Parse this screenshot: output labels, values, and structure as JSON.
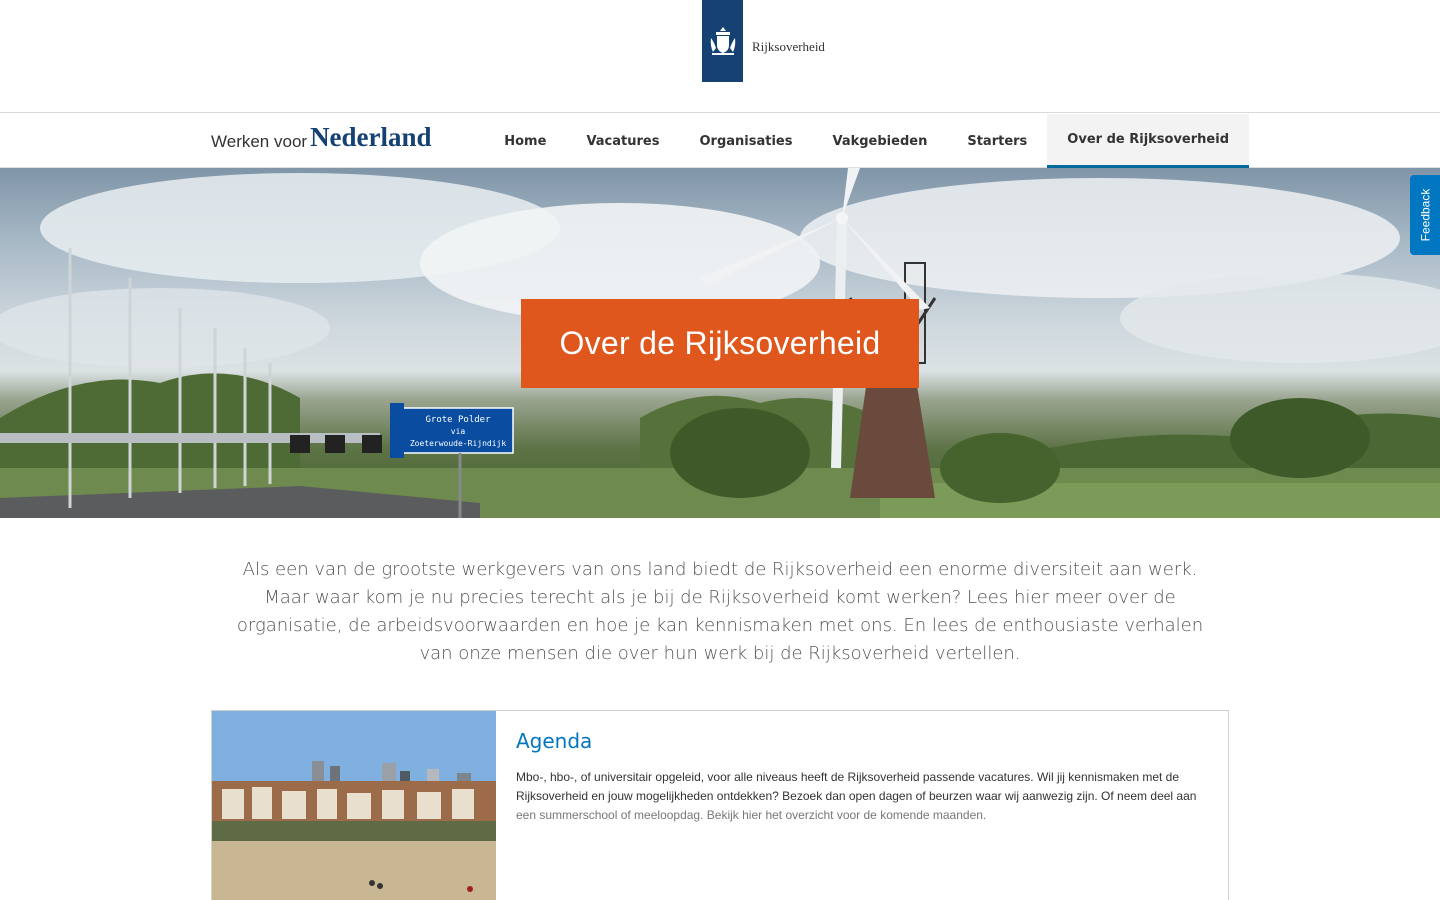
{
  "header": {
    "logo_text": "Rijksoverheid"
  },
  "brand": {
    "small": "Werken voor",
    "big": "Nederland"
  },
  "nav": {
    "items": [
      {
        "label": "Home"
      },
      {
        "label": "Vacatures"
      },
      {
        "label": "Organisaties"
      },
      {
        "label": "Vakgebieden"
      },
      {
        "label": "Starters"
      },
      {
        "label": "Over de Rijksoverheid"
      }
    ],
    "active_index": 5
  },
  "hero": {
    "title": "Over de Rijksoverheid",
    "sign_line1": "Grote Polder",
    "sign_line2": "via",
    "sign_line3": "Zoeterwoude-Rijndijk"
  },
  "feedback": {
    "label": "Feedback"
  },
  "intro": {
    "text": "Als een van de grootste werkgevers van ons land biedt de Rijksoverheid een enorme diversiteit aan werk. Maar waar kom je nu precies terecht als je bij de Rijksoverheid komt werken? Lees hier meer over de organisatie, de arbeidsvoorwaarden en hoe je kan kennismaken met ons. En lees de enthousiaste verhalen van onze mensen die over hun werk bij de Rijksoverheid vertellen."
  },
  "card": {
    "title": "Agenda",
    "text": "Mbo-, hbo-, of universitair opgeleid, voor alle niveaus heeft de Rijksoverheid passende vacatures. Wil jij kennismaken met de Rijksoverheid en jouw mogelijkheden ontdekken? Bezoek dan open dagen of beurzen waar wij aanwezig zijn. Of neem deel aan",
    "text_faded": "een summerschool of meeloopdag. Bekijk hier het overzicht voor de komende maanden."
  },
  "colors": {
    "accent_blue": "#0176c1",
    "brand_navy": "#154273",
    "hero_orange": "#e0571d"
  }
}
